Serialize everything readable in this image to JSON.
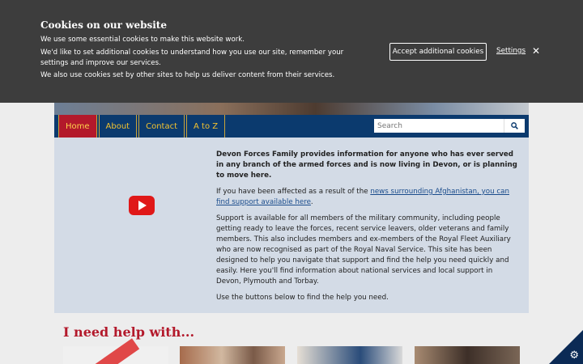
{
  "cookie_banner": {
    "title": "Cookies on our website",
    "line1": "We use some essential cookies to make this website work.",
    "line2": "We'd like to set additional cookies to understand how you use our site, remember your settings and improve our services.",
    "line3": "We also use cookies set by other sites to help us deliver content from their services.",
    "accept_label": "Accept additional cookies",
    "settings_label": "Settings",
    "close_glyph": "✕"
  },
  "nav": {
    "items": [
      {
        "label": "Home"
      },
      {
        "label": "About"
      },
      {
        "label": "Contact"
      },
      {
        "label": "A to Z"
      }
    ],
    "search_placeholder": "Search",
    "search_icon": "magnifier-icon"
  },
  "main": {
    "intro": "Devon Forces Family provides information for anyone who has ever served in any branch of the armed forces and is now living in Devon, or is planning to move here.",
    "affected_prefix": "If you have been affected as a result of the ",
    "affected_link": "news surrounding Afghanistan, you can find support available here",
    "affected_suffix": ".",
    "support": "Support is available for all members of the military community, including people getting ready to leave the forces, recent service leavers, older veterans and family members. This also includes members and ex-members of the Royal Fleet Auxiliary who are now recognised as part of the Royal Naval Service. This site has been designed to help you navigate that support and find the help you need quickly and easily. Here you'll find information about national services and local support in Devon, Plymouth and Torbay.",
    "buttons_hint": "Use the buttons below to find the help you need.",
    "video_icon": "youtube-play-icon"
  },
  "help": {
    "title": "I need help with..."
  },
  "corner": {
    "gear_glyph": "⚙"
  }
}
